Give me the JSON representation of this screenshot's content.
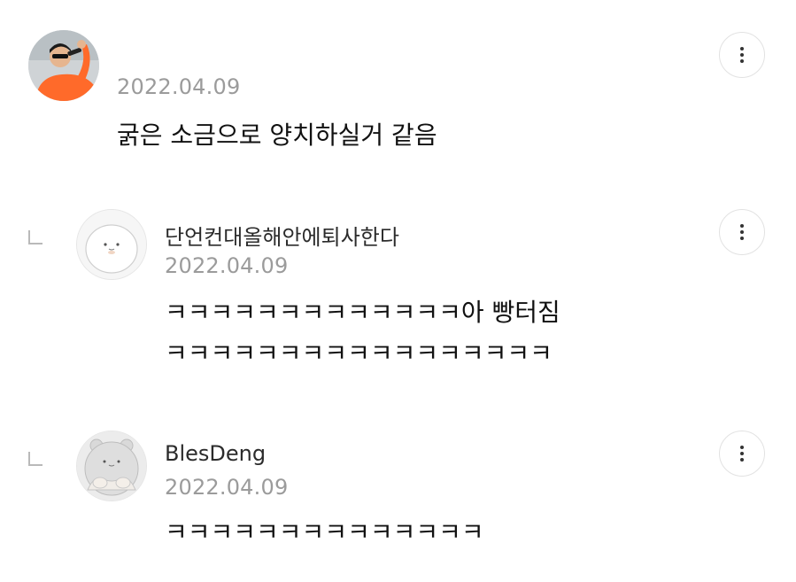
{
  "comments": [
    {
      "author": "",
      "date": "2022.04.09",
      "lines": [
        "굵은 소금으로 양치하실거 같음"
      ]
    }
  ],
  "replies": [
    {
      "author": "단언컨대올해안에퇴사한다",
      "date": "2022.04.09",
      "lines": [
        "ㅋㅋㅋㅋㅋㅋㅋㅋㅋㅋㅋㅋㅋ아 빵터짐",
        "ㅋㅋㅋㅋㅋㅋㅋㅋㅋㅋㅋㅋㅋㅋㅋㅋㅋ"
      ]
    },
    {
      "author": "BlesDeng",
      "date": "2022.04.09",
      "lines": [
        "ㅋㅋㅋㅋㅋㅋㅋㅋㅋㅋㅋㅋㅋㅋ"
      ]
    }
  ],
  "icons": {
    "more": "more-vertical-icon",
    "reply": "reply-indicator-icon"
  },
  "colors": {
    "date": "#9b9b9b",
    "text": "#111111",
    "border": "#e2e2e2",
    "avatar_shirt": "#ff6a2a"
  }
}
